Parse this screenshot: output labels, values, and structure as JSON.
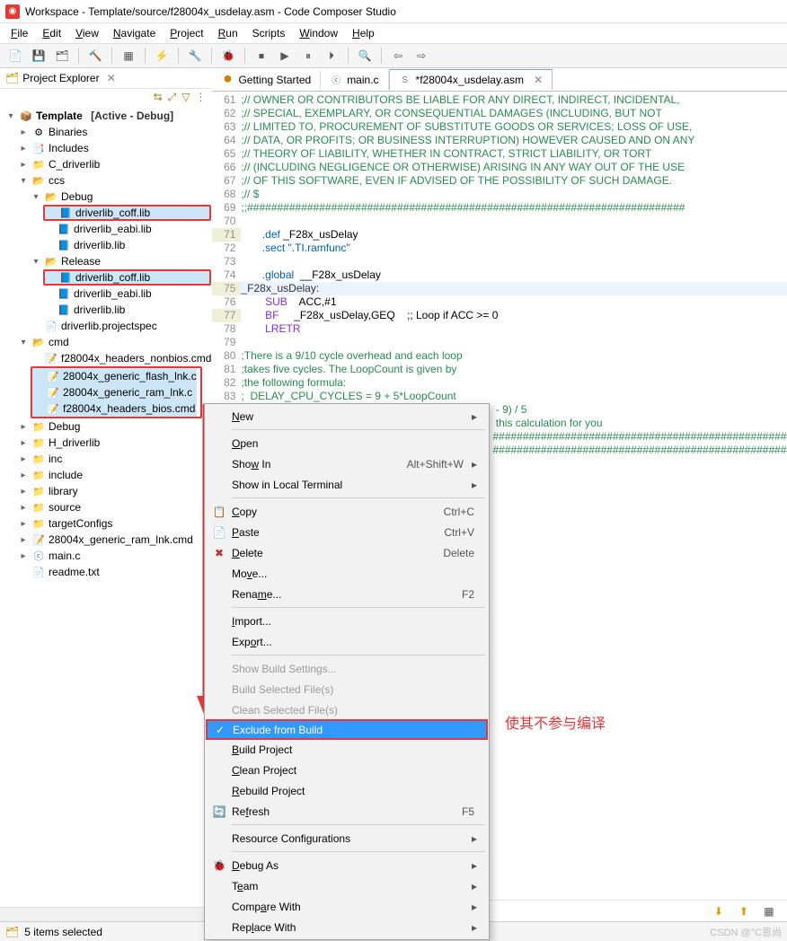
{
  "window": {
    "title": "Workspace - Template/source/f28004x_usdelay.asm - Code Composer Studio"
  },
  "menu": {
    "file": "File",
    "edit": "Edit",
    "view": "View",
    "navigate": "Navigate",
    "project": "Project",
    "run": "Run",
    "scripts": "Scripts",
    "window": "Window",
    "help": "Help"
  },
  "explorer": {
    "title": "Project Explorer"
  },
  "tree": {
    "project": "Template",
    "project_status": "[Active - Debug]",
    "binaries": "Binaries",
    "includes": "Includes",
    "c_driverlib": "C_driverlib",
    "ccs": "ccs",
    "debug": "Debug",
    "lib_coff_d": "driverlib_coff.lib",
    "lib_eabi_d": "driverlib_eabi.lib",
    "lib_d": "driverlib.lib",
    "release": "Release",
    "lib_coff_r": "driverlib_coff.lib",
    "lib_eabi_r": "driverlib_eabi.lib",
    "lib_r": "driverlib.lib",
    "projspec": "driverlib.projectspec",
    "cmd": "cmd",
    "cmd1": "f28004x_headers_nonbios.cmd",
    "cmd2": "28004x_generic_flash_lnk.c",
    "cmd3": "28004x_generic_ram_lnk.c",
    "cmd4": "f28004x_headers_bios.cmd",
    "debugf": "Debug",
    "hdrv": "H_driverlib",
    "inc": "inc",
    "include": "include",
    "library": "library",
    "source": "source",
    "tconf": "targetConfigs",
    "ramlnk": "28004x_generic_ram_lnk.cmd",
    "mainc": "main.c",
    "readme": "readme.txt"
  },
  "tabs": {
    "t0": "Getting Started",
    "t1": "main.c",
    "t2": "*f28004x_usdelay.asm"
  },
  "code": {
    "l61": ";// OWNER OR CONTRIBUTORS BE LIABLE FOR ANY DIRECT, INDIRECT, INCIDENTAL,",
    "l62": ";// SPECIAL, EXEMPLARY, OR CONSEQUENTIAL DAMAGES (INCLUDING, BUT NOT",
    "l63": ";// LIMITED TO, PROCUREMENT OF SUBSTITUTE GOODS OR SERVICES; LOSS OF USE,",
    "l64": ";// DATA, OR PROFITS; OR BUSINESS INTERRUPTION) HOWEVER CAUSED AND ON ANY",
    "l65": ";// THEORY OF LIABILITY, WHETHER IN CONTRACT, STRICT LIABILITY, OR TORT",
    "l66": ";// (INCLUDING NEGLIGENCE OR OTHERWISE) ARISING IN ANY WAY OUT OF THE USE",
    "l67": ";// OF THIS SOFTWARE, EVEN IF ADVISED OF THE POSSIBILITY OF SUCH DAMAGE.",
    "l68": ";// $",
    "l69": ";;#########################################################################",
    "l70": "",
    "l71a": "       .def",
    "l71b": " _F28x_usDelay",
    "l72a": "       .sect",
    "l72b": " \".TI.ramfunc\"",
    "l73": "",
    "l74a": "       .global",
    "l74b": "  __F28x_usDelay",
    "l75": "_F28x_usDelay:",
    "l76a": "        SUB",
    "l76b": "    ACC,#1",
    "l77a": "        BF",
    "l77b": "     _F28x_usDelay,GEQ    ;; Loop if ACC >= 0",
    "l78": "        LRETR",
    "l79": "",
    "l80": ";There is a 9/10 cycle overhead and each loop",
    "l81": ";takes five cycles. The LoopCount is given by",
    "l82": ";the following formula:",
    "l83": ";  DELAY_CPU_CYCLES = 9 + 5*LoopCount",
    "l84_tail": " - 9) / 5",
    "l85_tail": " this calculation for you",
    "l86": "",
    "l87": "#########################################################",
    "l88": "",
    "l89": "#########################################################"
  },
  "ctx": {
    "new": "New",
    "open": "Open",
    "showin": "Show In",
    "showin_sc": "Alt+Shift+W",
    "showlocal": "Show in Local Terminal",
    "copy": "Copy",
    "copy_sc": "Ctrl+C",
    "paste": "Paste",
    "paste_sc": "Ctrl+V",
    "delete": "Delete",
    "delete_sc": "Delete",
    "move": "Move...",
    "rename": "Rename...",
    "rename_sc": "F2",
    "import": "Import...",
    "export": "Export...",
    "showbuild": "Show Build Settings...",
    "buildsel": "Build Selected File(s)",
    "cleansel": "Clean Selected File(s)",
    "exclude": "Exclude from Build",
    "buildproj": "Build Project",
    "cleanproj": "Clean Project",
    "rebuild": "Rebuild Project",
    "refresh": "Refresh",
    "refresh_sc": "F5",
    "resconf": "Resource Configurations",
    "debugas": "Debug As",
    "team": "Team",
    "compare": "Compare With",
    "replace": "Replace With"
  },
  "annotation": "使其不参与编译",
  "status": {
    "text": "5 items selected"
  },
  "watermark": "CSDN @°C恩尚"
}
